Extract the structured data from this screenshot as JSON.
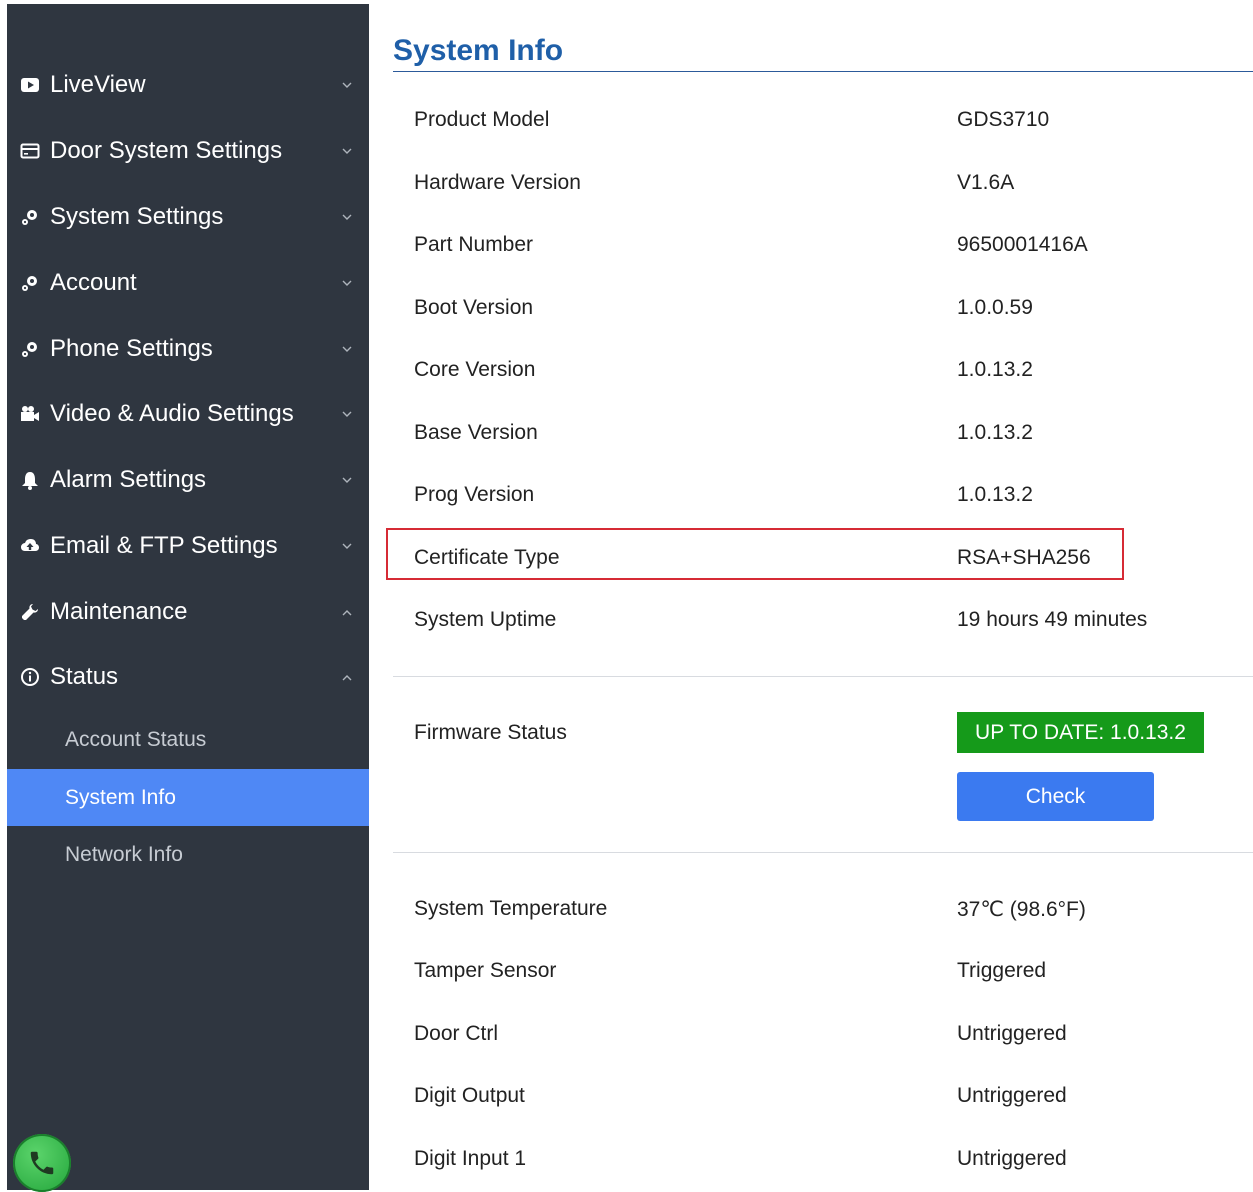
{
  "sidebar": {
    "items": [
      {
        "label": "LiveView",
        "icon": "play-icon"
      },
      {
        "label": "Door System Settings",
        "icon": "door-card-icon"
      },
      {
        "label": "System Settings",
        "icon": "gears-icon"
      },
      {
        "label": "Account",
        "icon": "gears-icon"
      },
      {
        "label": "Phone Settings",
        "icon": "gears-icon"
      },
      {
        "label": "Video & Audio Settings",
        "icon": "video-audio-icon"
      },
      {
        "label": "Alarm Settings",
        "icon": "bell-icon"
      },
      {
        "label": "Email & FTP Settings",
        "icon": "cloud-upload-icon"
      },
      {
        "label": "Maintenance",
        "icon": "wrench-icon"
      },
      {
        "label": "Status",
        "icon": "info-circle-icon"
      }
    ],
    "status_subitems": [
      {
        "label": "Account Status"
      },
      {
        "label": "System Info"
      },
      {
        "label": "Network Info"
      }
    ],
    "active_subitem": "System Info"
  },
  "main": {
    "title": "System Info",
    "rows": [
      {
        "label": "Product Model",
        "value": "GDS3710"
      },
      {
        "label": "Hardware Version",
        "value": "V1.6A"
      },
      {
        "label": "Part Number",
        "value": "9650001416A"
      },
      {
        "label": "Boot Version",
        "value": "1.0.0.59"
      },
      {
        "label": "Core Version",
        "value": "1.0.13.2"
      },
      {
        "label": "Base Version",
        "value": "1.0.13.2"
      },
      {
        "label": "Prog Version",
        "value": "1.0.13.2"
      },
      {
        "label": "Certificate Type",
        "value": "RSA+SHA256"
      },
      {
        "label": "System Uptime",
        "value": "19 hours 49 minutes"
      }
    ],
    "firmware": {
      "label": "Firmware Status",
      "badge": "UP TO DATE: 1.0.13.2",
      "check_button": "Check"
    },
    "status_rows": [
      {
        "label": "System Temperature",
        "value": "37℃ (98.6°F)"
      },
      {
        "label": "Tamper Sensor",
        "value": "Triggered"
      },
      {
        "label": "Door Ctrl",
        "value": "Untriggered"
      },
      {
        "label": "Digit Output",
        "value": "Untriggered"
      },
      {
        "label": "Digit Input 1",
        "value": "Untriggered"
      }
    ]
  },
  "colors": {
    "sidebar_bg": "#2f3640",
    "active_item": "#4f88f5",
    "title": "#1f5fa8",
    "badge_green": "#159a1a",
    "button_blue": "#3b7af0",
    "highlight_red": "#d62b35"
  }
}
